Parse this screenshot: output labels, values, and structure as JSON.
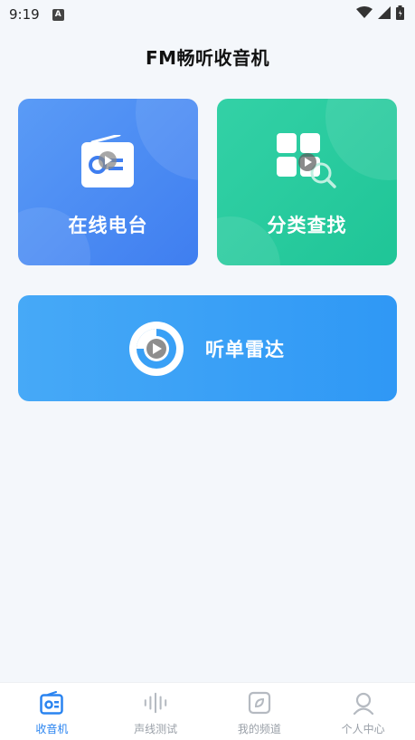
{
  "status_bar": {
    "time": "9:19",
    "notification_badge": "A"
  },
  "header": {
    "title": "FM畅听收音机"
  },
  "cards": {
    "online_radio": {
      "label": "在线电台",
      "icon": "radio-icon",
      "color": "#4a8cf3"
    },
    "category_search": {
      "label": "分类查找",
      "icon": "category-search-icon",
      "color": "#26c99c"
    },
    "song_radar": {
      "label": "听单雷达",
      "icon": "radar-icon",
      "color": "#3aa0f6"
    }
  },
  "bottom_nav": {
    "items": [
      {
        "label": "收音机",
        "icon": "radio-nav-icon",
        "active": true
      },
      {
        "label": "声线测试",
        "icon": "soundwave-icon",
        "active": false
      },
      {
        "label": "我的频道",
        "icon": "channel-icon",
        "active": false
      },
      {
        "label": "个人中心",
        "icon": "user-icon",
        "active": false
      }
    ],
    "active_color": "#2a84f0",
    "inactive_color": "#9aa0a8"
  }
}
